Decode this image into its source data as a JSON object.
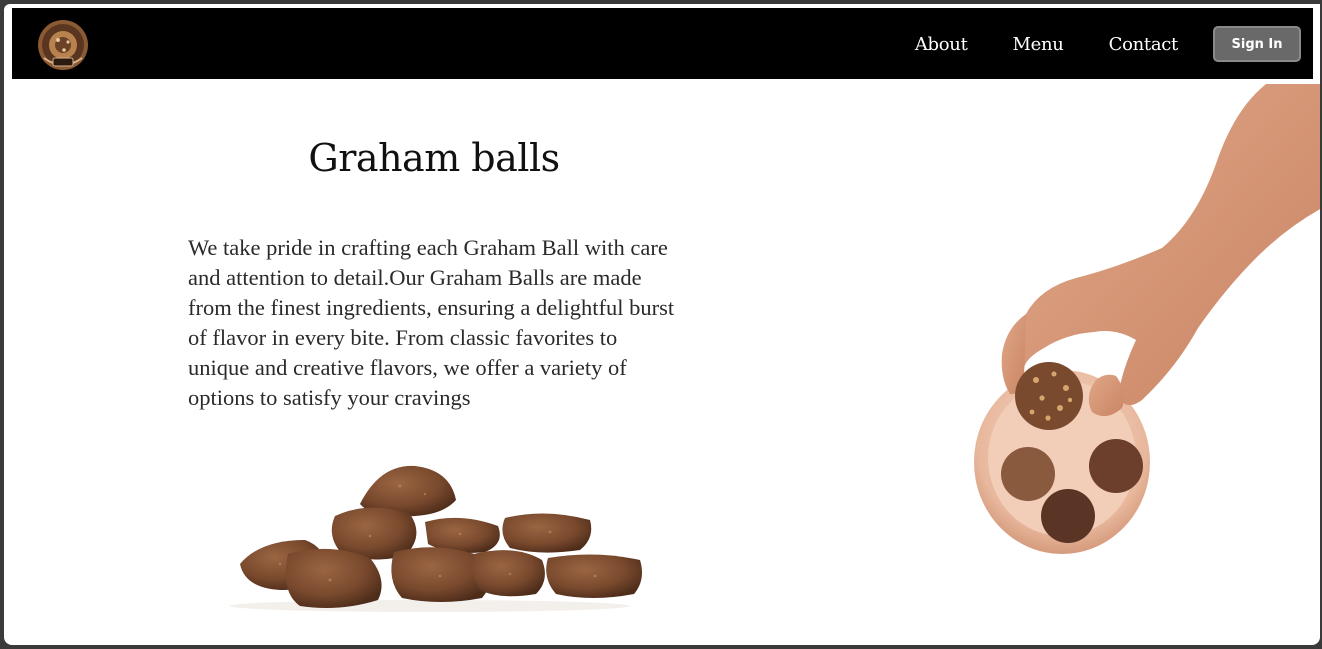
{
  "navbar": {
    "logo_alt": "Graham bites logo",
    "links": [
      {
        "label": "About"
      },
      {
        "label": "Menu"
      },
      {
        "label": "Contact"
      }
    ],
    "signin_label": "Sign In"
  },
  "hero": {
    "title": "Graham balls",
    "description": "We take pride in crafting each Graham Ball with care and attention to detail.Our Graham Balls are made from the finest ingredients, ensuring a delightful burst of flavor in every bite. From classic favorites to unique and creative flavors, we offer a variety of options to satisfy your cravings"
  },
  "colors": {
    "nav_bg": "#000000",
    "signin_bg": "#696969",
    "text": "#111111",
    "chocolate": "#7a4a2e"
  },
  "images": {
    "balls": "graham-balls-pile-image",
    "hand": "hand-holding-graham-ball-image"
  }
}
